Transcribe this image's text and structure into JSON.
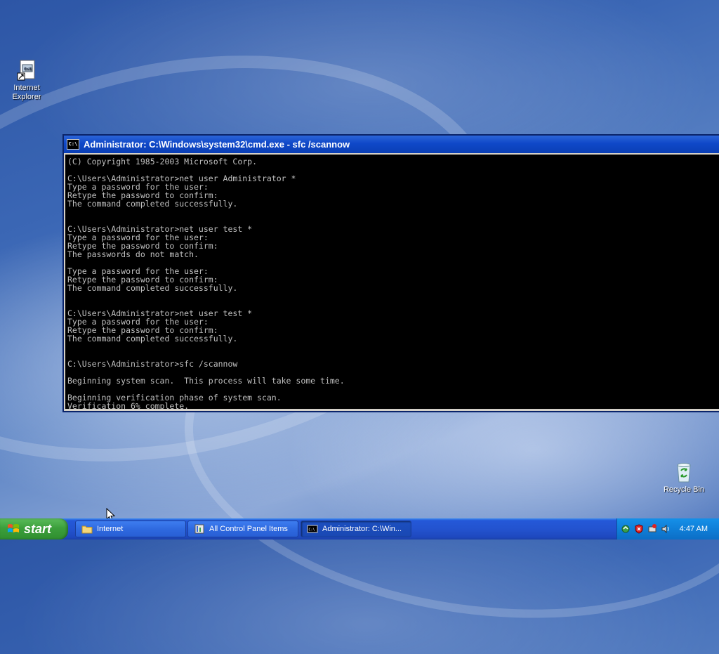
{
  "desktop": {
    "icons": [
      {
        "label_line1": "Internet",
        "label_line2": "Explorer",
        "icon": "internet-explorer-shortcut-icon"
      },
      {
        "label": "Recycle Bin",
        "icon": "recycle-bin-icon"
      }
    ]
  },
  "cmd": {
    "title": "Administrator: C:\\Windows\\system32\\cmd.exe - sfc  /scannow",
    "icon_text": "C:\\",
    "lines": [
      "(C) Copyright 1985-2003 Microsoft Corp.",
      "",
      "C:\\Users\\Administrator>net user Administrator *",
      "Type a password for the user:",
      "Retype the password to confirm:",
      "The command completed successfully.",
      "",
      "",
      "C:\\Users\\Administrator>net user test *",
      "Type a password for the user:",
      "Retype the password to confirm:",
      "The passwords do not match.",
      "",
      "Type a password for the user:",
      "Retype the password to confirm:",
      "The command completed successfully.",
      "",
      "",
      "C:\\Users\\Administrator>net user test *",
      "Type a password for the user:",
      "Retype the password to confirm:",
      "The command completed successfully.",
      "",
      "",
      "C:\\Users\\Administrator>sfc /scannow",
      "",
      "Beginning system scan.  This process will take some time.",
      "",
      "Beginning verification phase of system scan.",
      "Verification 6% complete."
    ]
  },
  "taskbar": {
    "start_label": "start",
    "buttons": [
      {
        "label": "Internet",
        "icon": "folder-icon"
      },
      {
        "label": "All Control Panel Items",
        "icon": "control-panel-icon"
      },
      {
        "label": "Administrator: C:\\Win...",
        "icon": "cmd-icon"
      }
    ],
    "tray_icons": [
      "network-icon",
      "security-alert-icon",
      "safely-remove-icon",
      "volume-icon"
    ],
    "clock": "4:47 AM"
  },
  "colors": {
    "titlebar": "#0f48c8",
    "console_bg": "#000000",
    "console_fg": "#c0c0c0",
    "taskbar": "#2353cf",
    "start_green": "#3c9f3c",
    "tray": "#0f7fd8"
  }
}
